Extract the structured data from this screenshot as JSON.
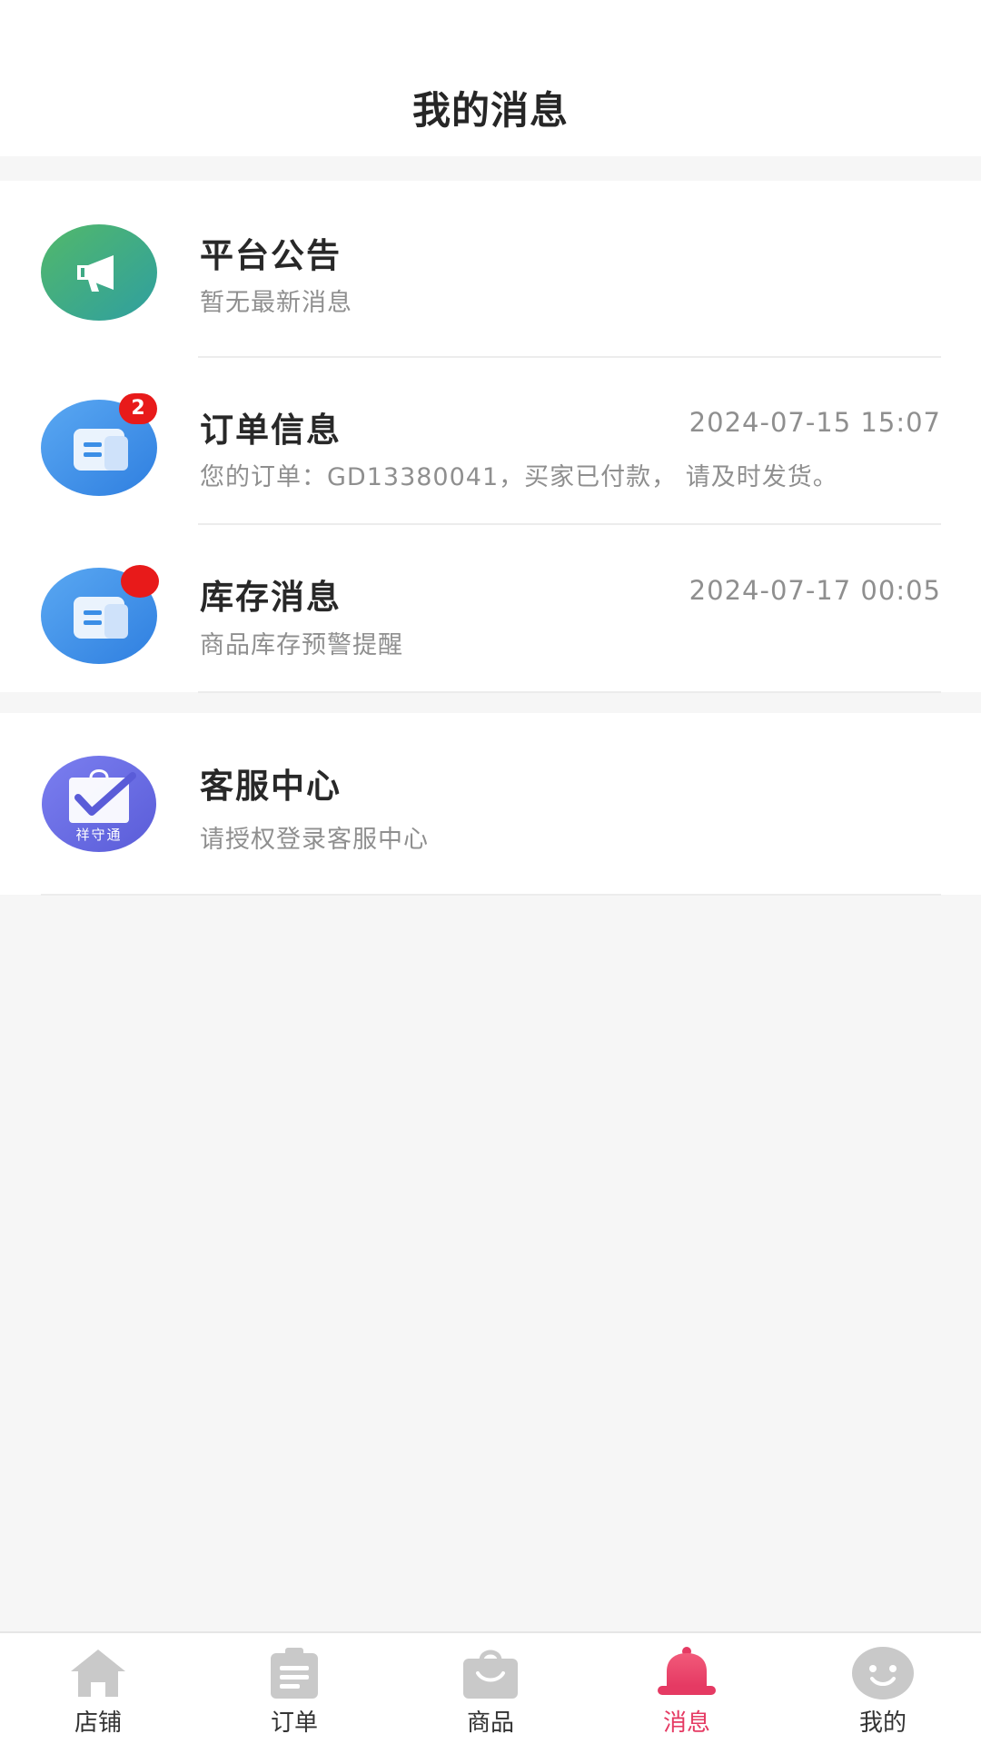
{
  "header": {
    "title": "我的消息"
  },
  "messages": [
    {
      "name": "平台公告",
      "subtitle": "暂无最新消息",
      "time": "",
      "badge": ""
    },
    {
      "name": "订单信息",
      "subtitle": "您的订单：GD13380041，买家已付款， 请及时发货。",
      "time": "2024-07-15 15:07",
      "badge": "2"
    },
    {
      "name": "库存消息",
      "subtitle": "商品库存预警提醒",
      "time": "2024-07-17 00:05",
      "badge": ""
    }
  ],
  "service": {
    "name": "客服中心",
    "subtitle": "请授权登录客服中心",
    "logo_text": "祥守通"
  },
  "tabbar": {
    "items": [
      {
        "label": "店铺",
        "icon": "home-icon"
      },
      {
        "label": "订单",
        "icon": "order-icon"
      },
      {
        "label": "商品",
        "icon": "bag-icon"
      },
      {
        "label": "消息",
        "icon": "bell-icon",
        "active": true
      },
      {
        "label": "我的",
        "icon": "smiley-icon"
      }
    ]
  },
  "colors": {
    "accent": "#e53a63",
    "badge": "#e81a1a",
    "announcement_icon": "#3fa985",
    "message_icon": "#3b8ee6",
    "service_icon": "#6b6fe6"
  }
}
